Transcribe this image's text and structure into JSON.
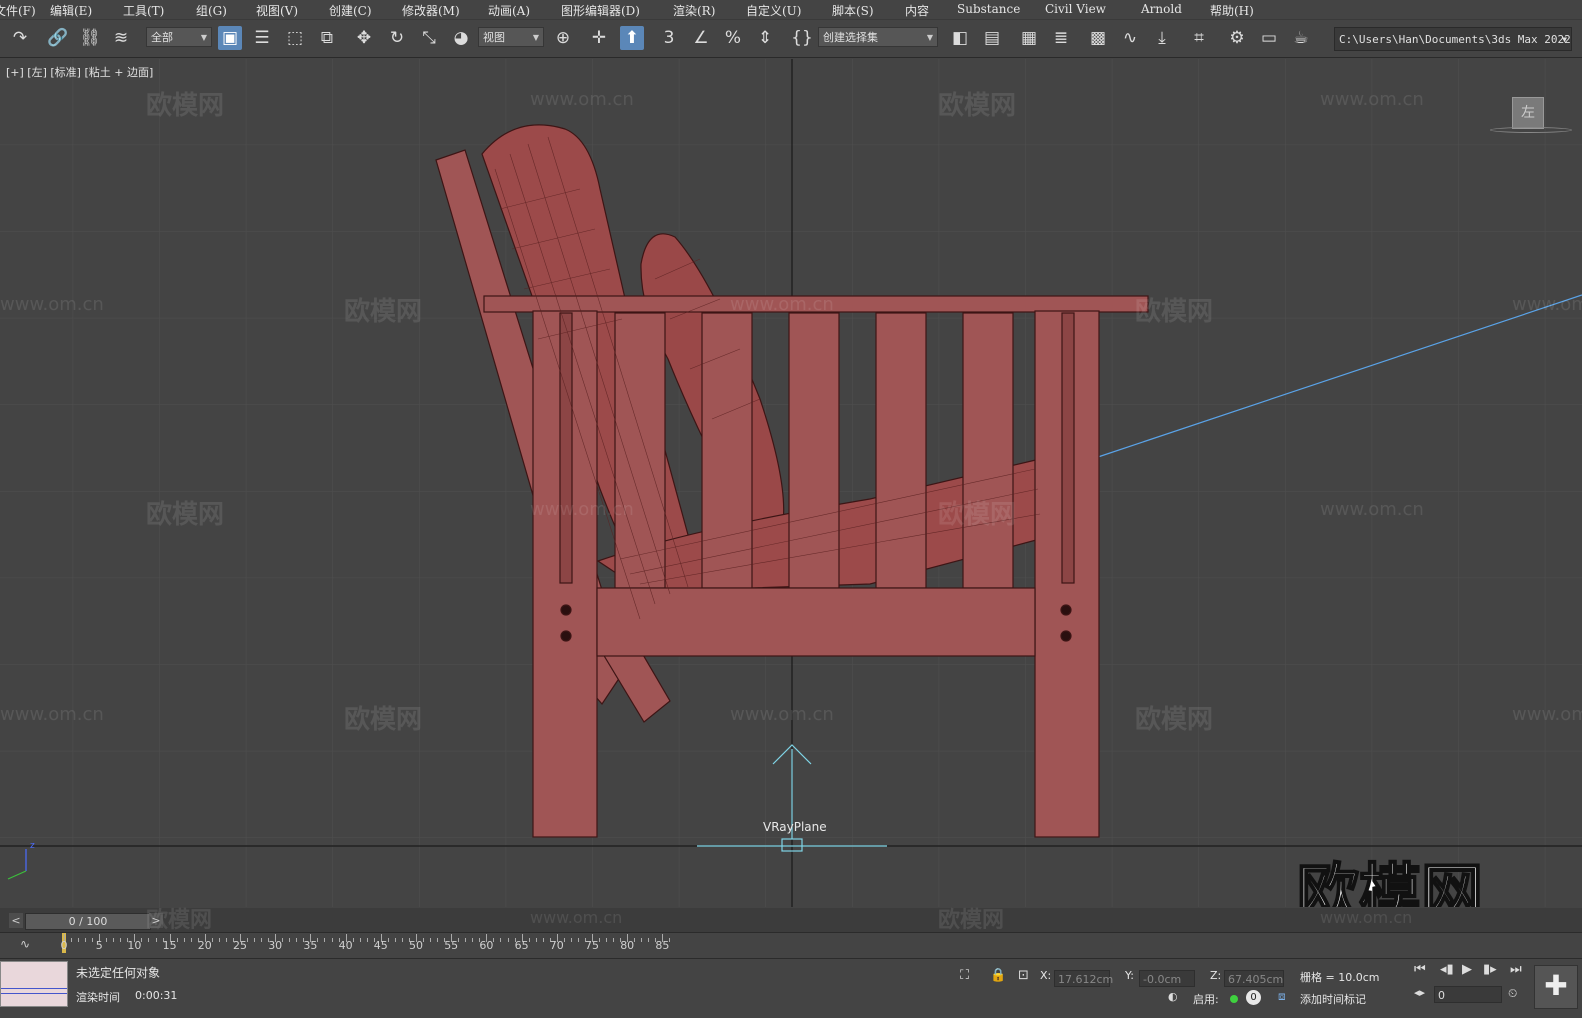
{
  "menu": [
    "文件(F)",
    "编辑(E)",
    "工具(T)",
    "组(G)",
    "视图(V)",
    "创建(C)",
    "修改器(M)",
    "动画(A)",
    "图形编辑器(D)",
    "渲染(R)",
    "自定义(U)",
    "脚本(S)",
    "内容",
    "Substance",
    "Civil View",
    "Arnold",
    "帮助(H)"
  ],
  "toolbar": {
    "filter_select": "全部",
    "ref_coord_select": "视图",
    "named_selection": "创建选择集",
    "project_path": "C:\\Users\\Han\\Documents\\3ds Max 2022"
  },
  "viewport": {
    "label": "[+] [左] [标准] [粘土 + 边面]",
    "object_label": "VRayPlane",
    "viewcube_label": "左",
    "watermark_cn": "欧模网",
    "watermark_en": "www.om.cn",
    "watermark_big": "欧模网",
    "axis_z": "z"
  },
  "timeslider": {
    "frame_display": "0 / 100",
    "prev": "<",
    "next": ">"
  },
  "ruler": {
    "ticks": [
      "0",
      "5",
      "10",
      "15",
      "20",
      "25",
      "30",
      "35",
      "40",
      "45",
      "50",
      "55",
      "60",
      "65",
      "70",
      "75",
      "80",
      "85"
    ]
  },
  "status": {
    "selection": "未选定任何对象",
    "render_time_label": "渲染时间",
    "render_time": "0:00:31",
    "x_label": "X:",
    "x_value": "17.612cm",
    "y_label": "Y:",
    "y_value": "-0.0cm",
    "z_label": "Z:",
    "z_value": "67.405cm",
    "grid": "栅格 = 10.0cm",
    "enable_label": "启用:",
    "enable_count": "0",
    "add_time_tag": "添加时间标记",
    "frame_field": "0"
  },
  "colors": {
    "accent": "#5b87b8",
    "model": "#a05555",
    "model_dark": "#4a1c1c",
    "grid": "#4e4e4e",
    "vray_plane": "#7fd4e6"
  }
}
